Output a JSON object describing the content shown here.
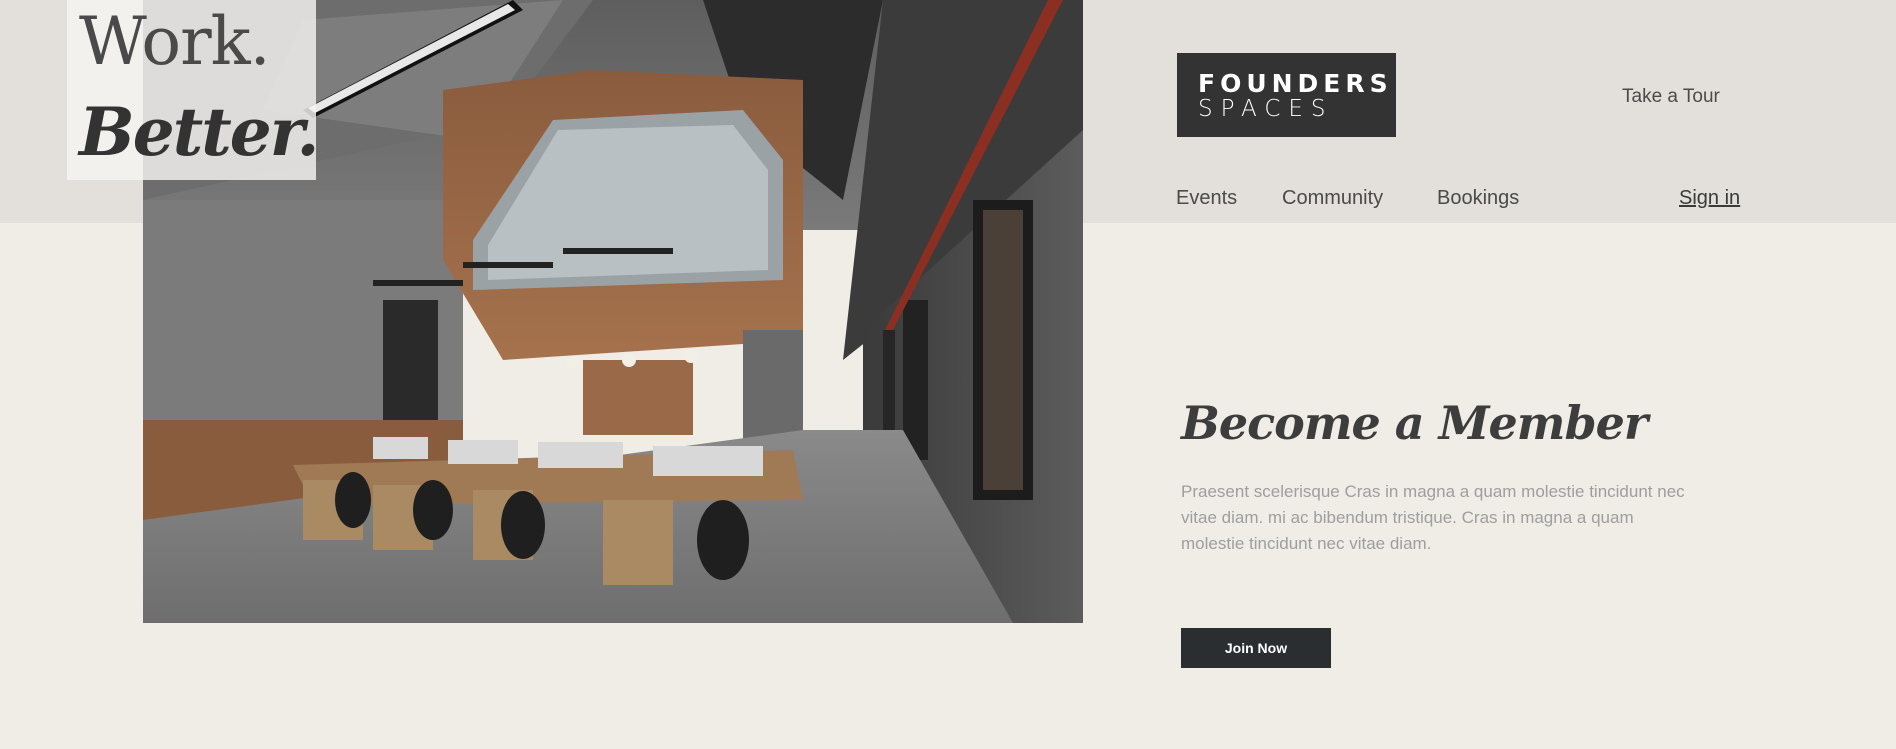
{
  "tagline": {
    "line1": "Work.",
    "line2": "Better."
  },
  "logo": {
    "line1": "FOUNDERS",
    "line2": "SPACES"
  },
  "header": {
    "tour_label": "Take a Tour",
    "signin_label": "Sign in"
  },
  "nav": {
    "items": [
      {
        "label": "Events"
      },
      {
        "label": "Community"
      },
      {
        "label": "Bookings"
      }
    ]
  },
  "member": {
    "title": "Become a Member",
    "description": "Praesent scelerisque Cras in magna a quam molestie tincidunt nec vitae diam. mi ac bibendum tristique. Cras in magna a quam molestie tincidunt nec vitae diam.",
    "join_label": "Join Now"
  },
  "colors": {
    "page_background": "#efede6",
    "header_band": "#e3e0db",
    "logo_background": "#333333",
    "button_background": "#2b2e31",
    "description_text": "#9e9e9e"
  },
  "images": {
    "hero": "office-interior-photo"
  }
}
